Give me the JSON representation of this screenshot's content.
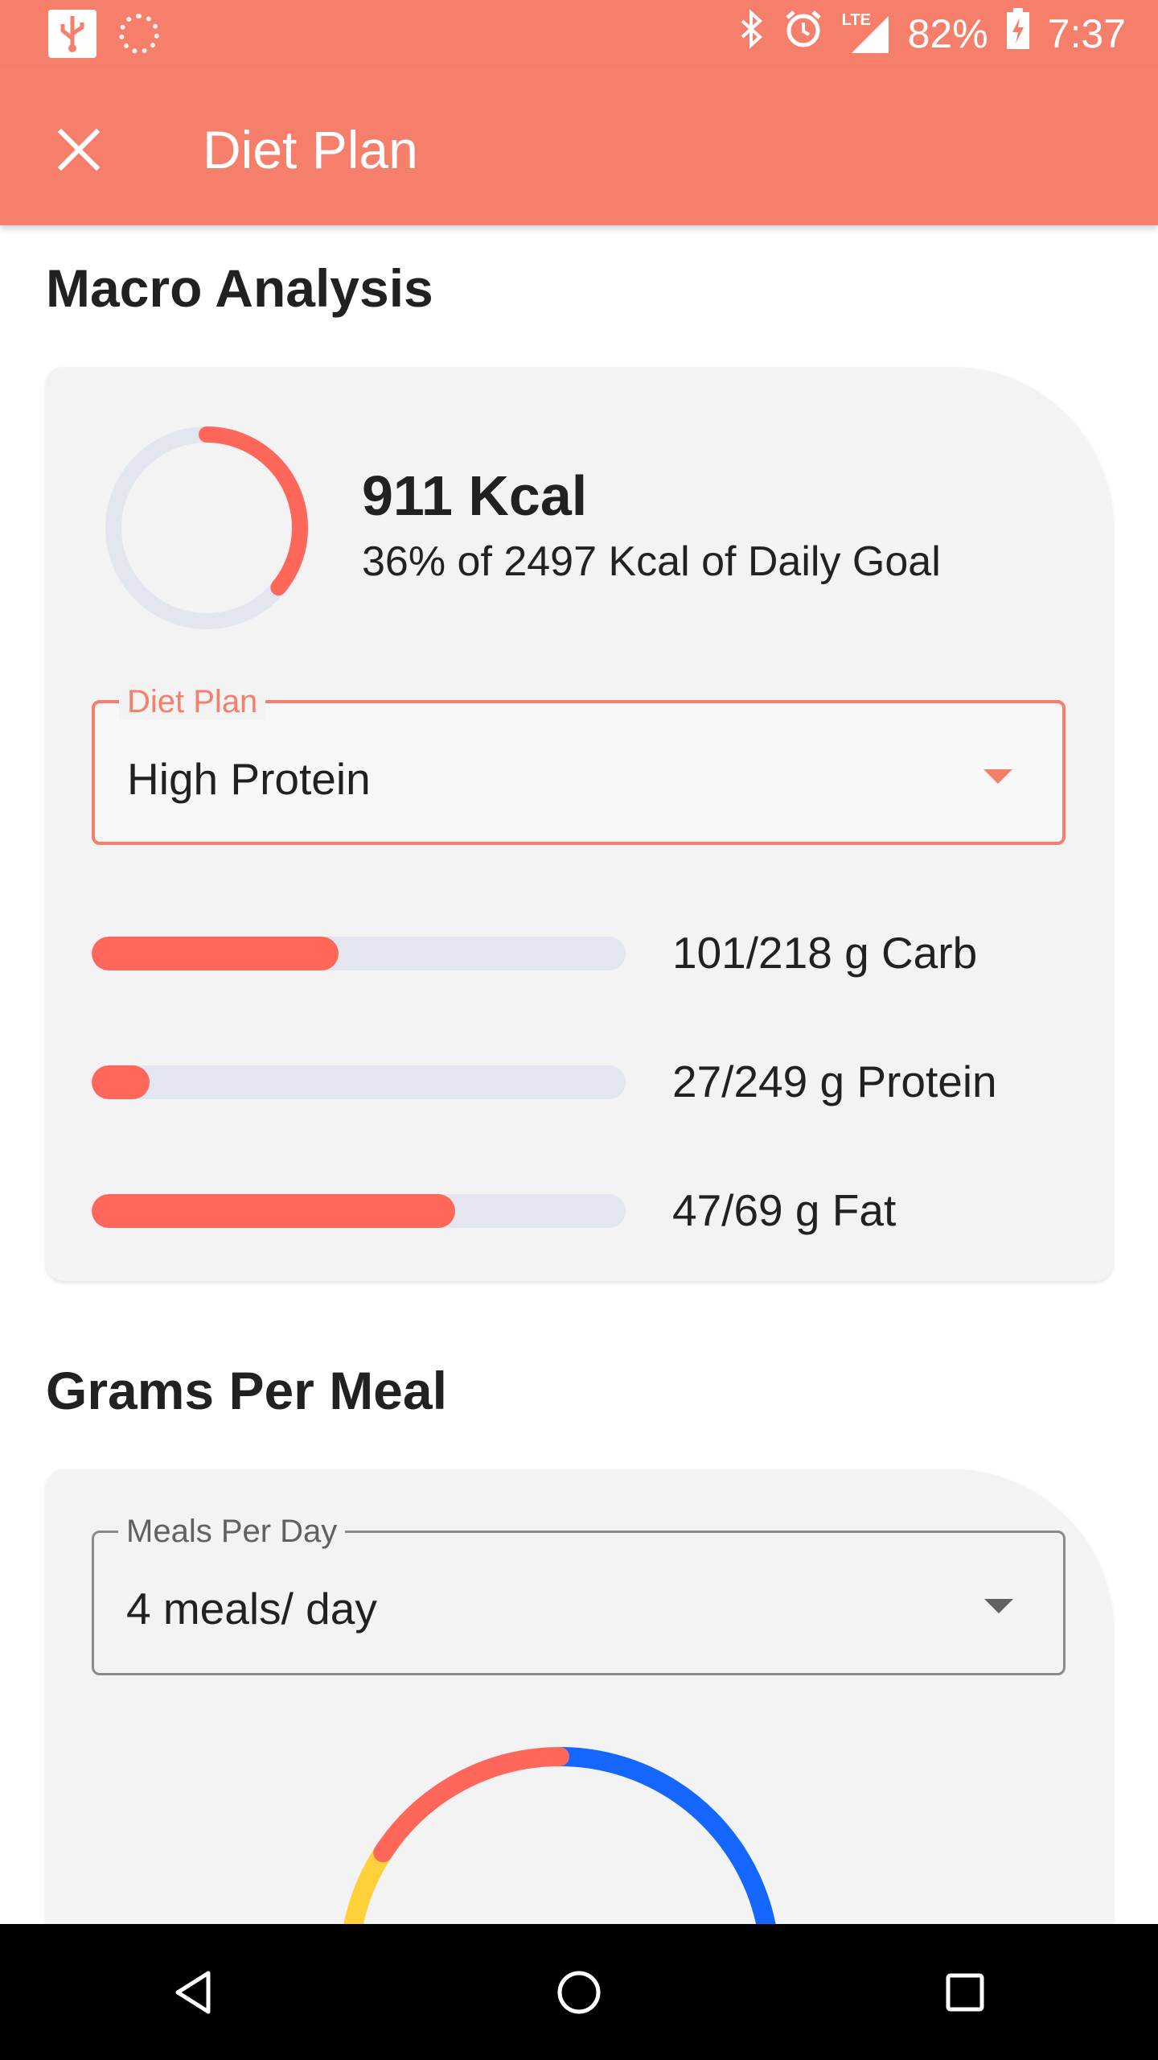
{
  "status_bar": {
    "icons": [
      "usb-icon",
      "sync-icon",
      "bluetooth-icon",
      "alarm-icon",
      "lte-signal-icon",
      "battery-charging-icon"
    ],
    "network": "LTE",
    "battery": "82%",
    "time": "7:37"
  },
  "app_bar": {
    "close_icon": "close-icon",
    "title": "Diet Plan"
  },
  "macro_analysis": {
    "title": "Macro Analysis",
    "kcal": "911 Kcal",
    "kcal_subtitle": "36% of 2497 Kcal of Daily Goal",
    "kcal_progress": 0.36,
    "colors": {
      "accent": "#FE6759",
      "track": "#E4E6EF"
    },
    "diet_plan": {
      "label": "Diet Plan",
      "value": "High Protein"
    },
    "macros": [
      {
        "label": "101/218 g Carb",
        "fraction": 0.463
      },
      {
        "label": "27/249 g Protein",
        "fraction": 0.108
      },
      {
        "label": "47/69 g Fat",
        "fraction": 0.681
      }
    ]
  },
  "grams_per_meal": {
    "title": "Grams Per Meal",
    "meals_per_day": {
      "label": "Meals Per Day",
      "value": "4 meals/ day"
    },
    "ring_colors": [
      "#FE6759",
      "#1565FF",
      "#FFD03A"
    ]
  },
  "nav_bar": {
    "icons": [
      "back-icon",
      "home-icon",
      "recents-icon"
    ]
  }
}
